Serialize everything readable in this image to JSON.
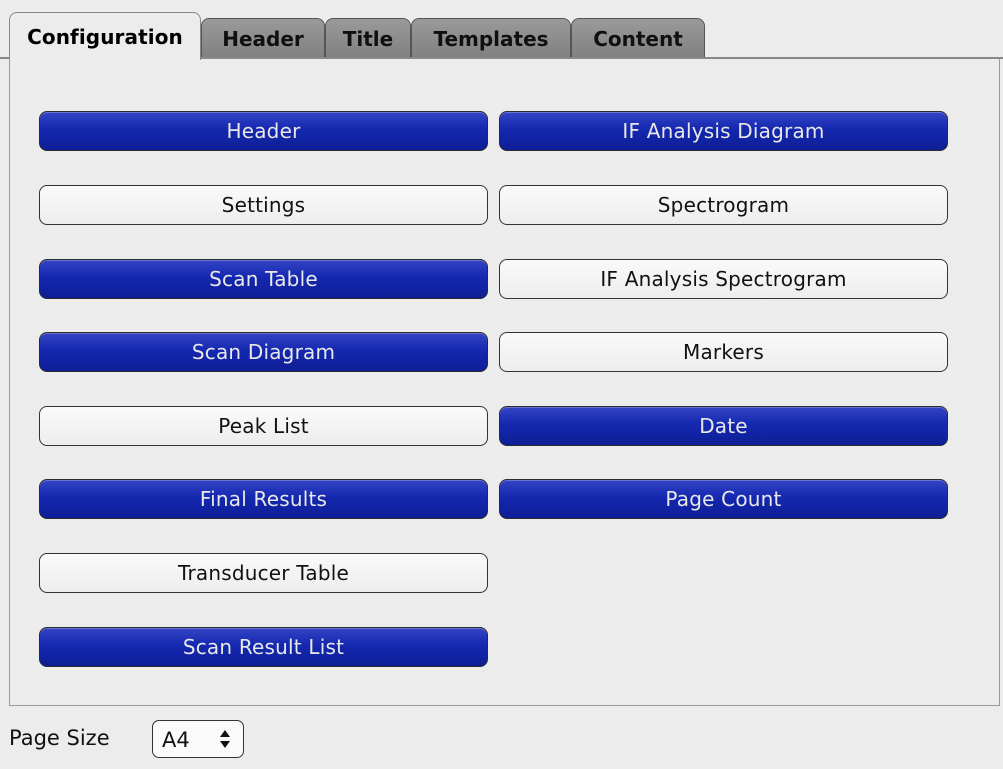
{
  "tabs": [
    {
      "label": "Configuration",
      "active": true
    },
    {
      "label": "Header",
      "active": false
    },
    {
      "label": "Title",
      "active": false
    },
    {
      "label": "Templates",
      "active": false
    },
    {
      "label": "Content",
      "active": false
    }
  ],
  "colors": {
    "selected": "#1428b0",
    "unselected": "#f5f5f5",
    "background": "#ececec"
  },
  "options": {
    "header": {
      "label": "Header",
      "selected": true
    },
    "settings": {
      "label": "Settings",
      "selected": false
    },
    "scan_table": {
      "label": "Scan Table",
      "selected": true
    },
    "scan_diagram": {
      "label": "Scan Diagram",
      "selected": true
    },
    "peak_list": {
      "label": "Peak List",
      "selected": false
    },
    "final_results": {
      "label": "Final Results",
      "selected": true
    },
    "transducer_table": {
      "label": "Transducer Table",
      "selected": false
    },
    "scan_result_list": {
      "label": "Scan Result List",
      "selected": true
    },
    "if_analysis_diagram": {
      "label": "IF Analysis Diagram",
      "selected": true
    },
    "spectrogram": {
      "label": "Spectrogram",
      "selected": false
    },
    "if_analysis_spectrogram": {
      "label": "IF Analysis Spectrogram",
      "selected": false
    },
    "markers": {
      "label": "Markers",
      "selected": false
    },
    "date": {
      "label": "Date",
      "selected": true
    },
    "page_count": {
      "label": "Page Count",
      "selected": true
    }
  },
  "page_size": {
    "label": "Page Size",
    "value": "A4"
  }
}
